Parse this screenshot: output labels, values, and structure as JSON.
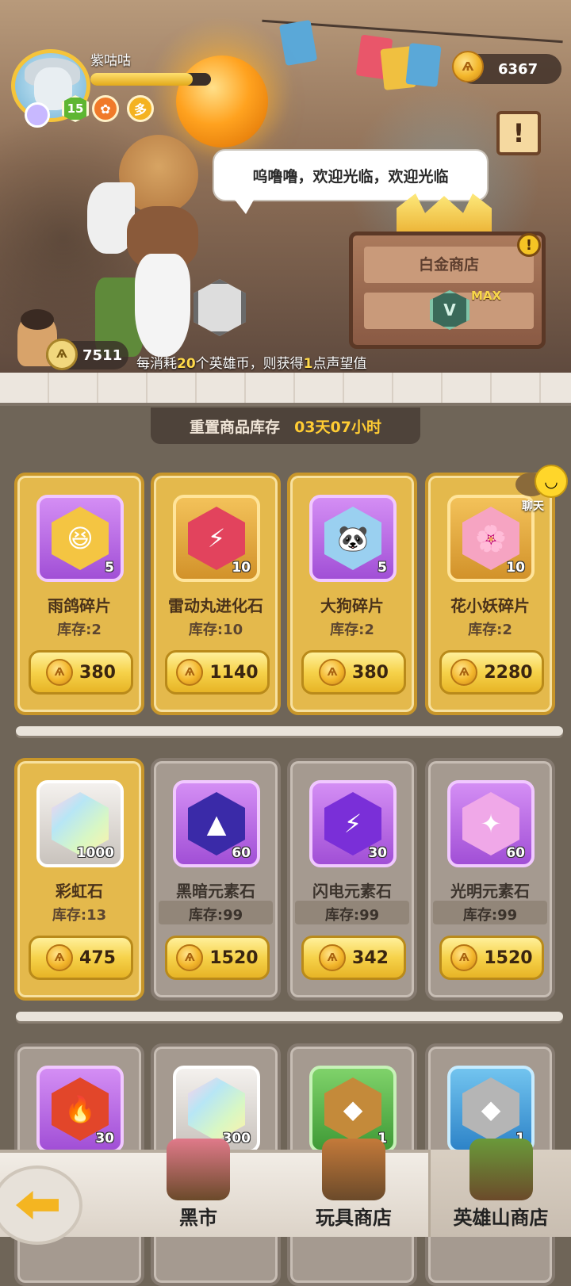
{
  "player": {
    "name": "紫咕咕",
    "level": "15",
    "exp_fraction": 0.85
  },
  "currency": {
    "coins": "6367",
    "reputation": "7511"
  },
  "npc": {
    "speech": "呜噜噜，欢迎光临，欢迎光临"
  },
  "shop": {
    "name": "白金商店",
    "rank_badge": "V",
    "rank_max": "MAX"
  },
  "reputation_note": {
    "prefix": "每消耗",
    "amount": "20",
    "middle": "个英雄币，则获得",
    "points": "1",
    "suffix": "点声望值"
  },
  "reset": {
    "label": "重置商品库存",
    "time": "03天07小时"
  },
  "chat": {
    "label": "聊天"
  },
  "items": [
    {
      "name": "雨鸽碎片",
      "stock": "库存:2",
      "qty": "5",
      "price": "380",
      "frame": "purple",
      "icon": "rain-pigeon-shard-icon",
      "gem_color": "#f4c542",
      "glyph": "😆",
      "card": "gold"
    },
    {
      "name": "雷动丸进化石",
      "stock": "库存:10",
      "qty": "10",
      "price": "1140",
      "frame": "gold",
      "icon": "thunder-evolution-stone-icon",
      "gem_color": "#e2435d",
      "glyph": "⚡",
      "card": "gold"
    },
    {
      "name": "大狗碎片",
      "stock": "库存:2",
      "qty": "5",
      "price": "380",
      "frame": "purple",
      "icon": "big-dog-shard-icon",
      "gem_color": "#9ad0f0",
      "glyph": "🐼",
      "card": "gold"
    },
    {
      "name": "花小妖碎片",
      "stock": "库存:2",
      "qty": "10",
      "price": "2280",
      "frame": "gold",
      "icon": "flower-sprite-shard-icon",
      "gem_color": "#f6a4c2",
      "glyph": "🌸",
      "card": "gold"
    },
    {
      "name": "彩虹石",
      "stock": "库存:13",
      "qty": "1000",
      "price": "475",
      "frame": "white",
      "icon": "rainbow-stone-icon",
      "gem_color": "#b7e6f5",
      "glyph": "",
      "card": "gold"
    },
    {
      "name": "黑暗元素石",
      "stock": "库存:99",
      "qty": "60",
      "price": "1520",
      "frame": "purple",
      "icon": "dark-element-stone-icon",
      "gem_color": "#3a2aa8",
      "glyph": "▲",
      "card": "grey"
    },
    {
      "name": "闪电元素石",
      "stock": "库存:99",
      "qty": "30",
      "price": "342",
      "frame": "purple",
      "icon": "lightning-element-stone-icon",
      "gem_color": "#7a2fd8",
      "glyph": "⚡",
      "card": "grey"
    },
    {
      "name": "光明元素石",
      "stock": "库存:99",
      "qty": "60",
      "price": "1520",
      "frame": "purple",
      "icon": "light-element-stone-icon",
      "gem_color": "#f0a8e8",
      "glyph": "✦",
      "card": "grey"
    },
    {
      "name": "",
      "stock": "",
      "qty": "30",
      "price": "",
      "frame": "purple",
      "icon": "fire-element-stone-icon",
      "gem_color": "#e2462a",
      "glyph": "🔥",
      "card": "grey"
    },
    {
      "name": "",
      "stock": "",
      "qty": "300",
      "price": "",
      "frame": "white",
      "icon": "rainbow-stone-icon",
      "gem_color": "#b7e6f5",
      "glyph": "",
      "card": "grey"
    },
    {
      "name": "",
      "stock": "",
      "qty": "1",
      "price": "",
      "frame": "green",
      "icon": "bronze-amulet-icon",
      "gem_color": "#c48a3a",
      "glyph": "◆",
      "card": "grey"
    },
    {
      "name": "",
      "stock": "",
      "qty": "1",
      "price": "",
      "frame": "blue",
      "icon": "silver-amulet-icon",
      "gem_color": "#b5b5b5",
      "glyph": "◆",
      "card": "grey"
    }
  ],
  "nav": {
    "tabs": [
      {
        "label": "黑市",
        "icon": "black-market-icon",
        "color": "#e07a8a"
      },
      {
        "label": "玩具商店",
        "icon": "toy-shop-icon",
        "color": "#c47a3a"
      },
      {
        "label": "英雄山商店",
        "icon": "hero-mountain-shop-icon",
        "color": "#6a9a3a"
      }
    ],
    "active": 2
  },
  "colors": {
    "accent_gold": "#f6d24a",
    "timer": "#ffcc33",
    "highlight": "#ffd94a"
  }
}
